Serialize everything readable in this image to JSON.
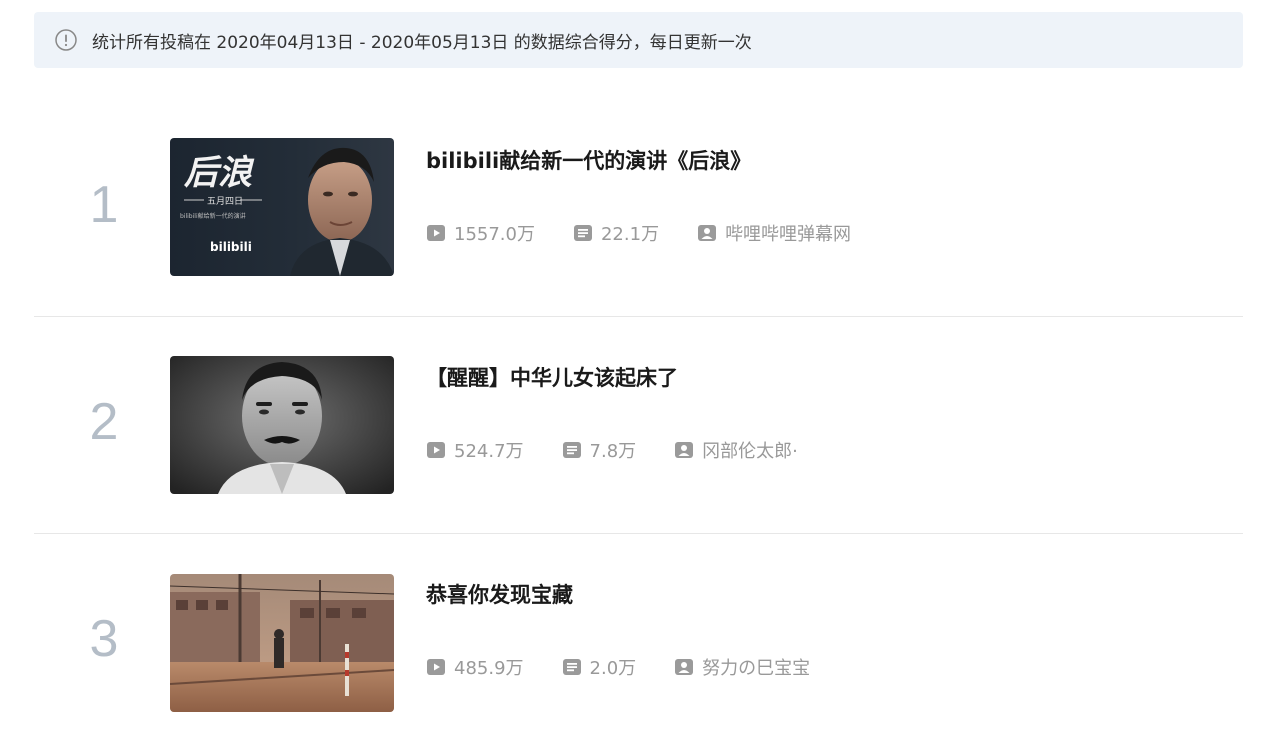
{
  "notice": {
    "text": "统计所有投稿在 2020年04月13日 - 2020年05月13日 的数据综合得分，每日更新一次",
    "icon": "info-circle-icon"
  },
  "items": [
    {
      "rank": "1",
      "title": "bilibili献给新一代的演讲《后浪》",
      "plays": "1557.0万",
      "danmaku": "22.1万",
      "author": "哔哩哔哩弹幕网",
      "thumb_calligraphy": "后浪",
      "thumb_caption": "五月四日",
      "thumb_subcaption": "bilibili献给新一代的演讲",
      "thumb_logo": "bilibili"
    },
    {
      "rank": "2",
      "title": "【醒醒】中华儿女该起床了",
      "plays": "524.7万",
      "danmaku": "7.8万",
      "author": "冈部伦太郎·"
    },
    {
      "rank": "3",
      "title": "恭喜你发现宝藏",
      "plays": "485.9万",
      "danmaku": "2.0万",
      "author": "努力の巳宝宝"
    }
  ],
  "icons": {
    "play": "play-icon",
    "danmaku": "danmaku-icon",
    "author": "up-user-icon"
  },
  "colors": {
    "notice_bg": "#eef3f9",
    "rank_number": "#b4bdc7",
    "meta_text": "#999999",
    "divider": "#e7e7e7"
  }
}
